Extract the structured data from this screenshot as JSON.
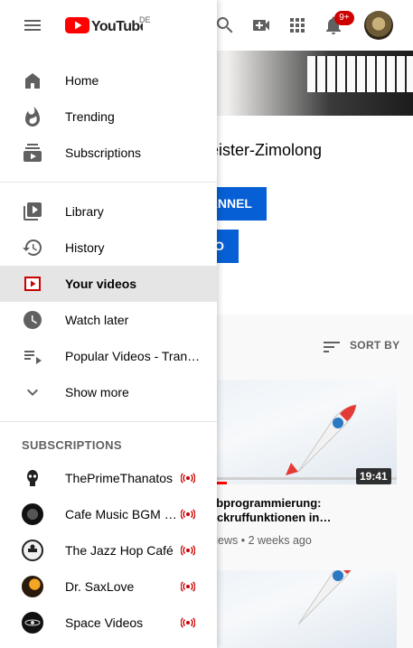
{
  "header": {
    "logo_text": "YouTube",
    "country_code": "DE",
    "notification_count": "9+"
  },
  "channel": {
    "name_visible": "eister-Zimolong",
    "subscribe_button_visible": "ANNEL",
    "second_button_visible": "O",
    "sort_label": "SORT BY"
  },
  "videos": [
    {
      "title_visible": "ebprogrammierung: ückruffunktionen in…",
      "views_visible": "views",
      "age": "2 weeks ago",
      "duration": "19:41",
      "watched_fraction": 0.09
    }
  ],
  "drawer": {
    "main_items": [
      {
        "label": "Home",
        "icon": "home-icon"
      },
      {
        "label": "Trending",
        "icon": "trending-icon"
      },
      {
        "label": "Subscriptions",
        "icon": "subscriptions-icon"
      }
    ],
    "library_items": [
      {
        "label": "Library",
        "icon": "library-icon"
      },
      {
        "label": "History",
        "icon": "history-icon"
      },
      {
        "label": "Your videos",
        "icon": "your-videos-icon",
        "active": true
      },
      {
        "label": "Watch later",
        "icon": "watch-later-icon"
      },
      {
        "label": "Popular Videos - Tran…",
        "icon": "playlist-icon"
      },
      {
        "label": "Show more",
        "icon": "chevron-down-icon"
      }
    ],
    "subscriptions_title": "SUBSCRIPTIONS",
    "subscriptions": [
      {
        "name": "ThePrimeThanatos",
        "live": true
      },
      {
        "name": "Cafe Music BGM c…",
        "live": true
      },
      {
        "name": "The Jazz Hop Café",
        "live": true
      },
      {
        "name": "Dr. SaxLove",
        "live": true
      },
      {
        "name": "Space Videos",
        "live": true
      }
    ]
  },
  "colors": {
    "brand_red": "#ff0000",
    "accent_blue": "#065fd4",
    "live_red": "#cc0000",
    "active_bg": "#e5e5e5"
  }
}
